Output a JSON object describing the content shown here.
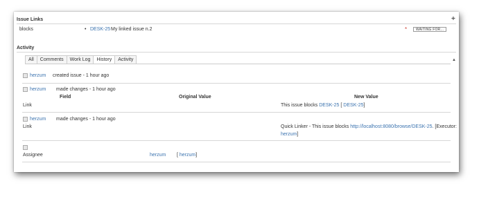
{
  "issue_links": {
    "title": "Issue Links",
    "add_icon": "plus-icon",
    "relation": "blocks",
    "bullet": "•",
    "issue_key": "DESK-25",
    "issue_summary": "My linked issue n.2",
    "priority_star": "*",
    "status": "WAITING FOR..."
  },
  "activity": {
    "title": "Activity",
    "collapse_icon": "arrow-up-icon",
    "tabs": [
      {
        "label": "All",
        "active": false
      },
      {
        "label": "Comments",
        "active": false
      },
      {
        "label": "Work Log",
        "active": false
      },
      {
        "label": "History",
        "active": true
      },
      {
        "label": "Activity",
        "active": false
      }
    ],
    "entries": [
      {
        "user": "herzum",
        "action": "created issue - 1 hour ago"
      },
      {
        "user": "herzum",
        "action": "made changes - 1 hour ago",
        "headers": {
          "field": "Field",
          "original": "Original Value",
          "new": "New Value"
        },
        "field": "Link",
        "new_prefix": "This issue blocks",
        "new_link1": "DESK-25",
        "new_bracket_open": "[",
        "new_link2": "DESK-25",
        "new_bracket_close": "]"
      },
      {
        "user": "herzum",
        "action": "made changes - 1 hour ago",
        "field": "Link",
        "new_prefix": "Quick Linker - This issue blocks",
        "new_url": "http://localhost:8080/browse/DESK-25",
        "new_suffix": ". [Executor:",
        "new_user": "herzum",
        "new_close": "]"
      },
      {
        "field": "Assignee",
        "original": "herzum",
        "new_open": "[",
        "new_user": "herzum",
        "new_close": "]"
      }
    ]
  }
}
